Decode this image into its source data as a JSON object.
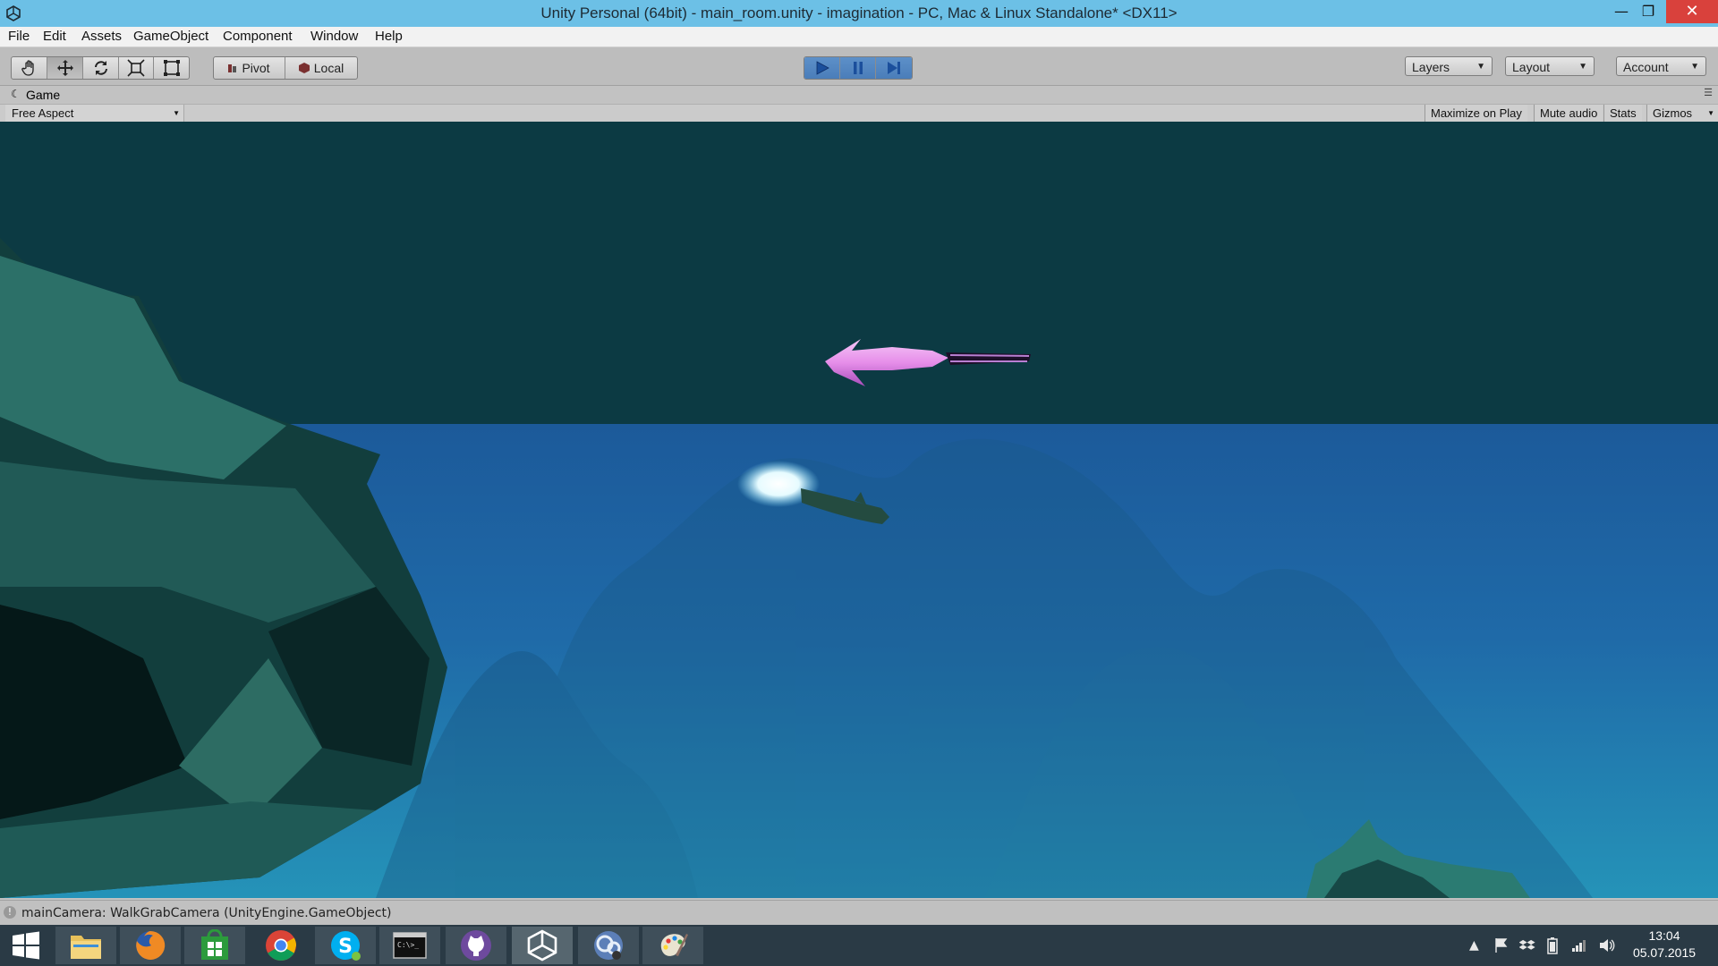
{
  "window": {
    "title": "Unity Personal (64bit) - main_room.unity - imagination - PC, Mac & Linux Standalone* <DX11>",
    "minimize_glyph": "—",
    "maximize_glyph": "❐",
    "close_glyph": "✕"
  },
  "menu": [
    "File",
    "Edit",
    "Assets",
    "GameObject",
    "Component",
    "Window",
    "Help"
  ],
  "toolbar": {
    "pivot_label": "Pivot",
    "local_label": "Local",
    "layers_label": "Layers",
    "layout_label": "Layout",
    "account_label": "Account"
  },
  "game_view": {
    "tab_label": "Game",
    "aspect_label": "Free Aspect",
    "maximize_label": "Maximize on Play",
    "mute_label": "Mute audio",
    "stats_label": "Stats",
    "gizmos_label": "Gizmos"
  },
  "status": {
    "message": "mainCamera: WalkGrabCamera (UnityEngine.GameObject)"
  },
  "taskbar": {
    "apps": [
      "windows-start",
      "file-explorer",
      "firefox",
      "store",
      "chrome",
      "skype",
      "command-prompt",
      "github",
      "unity",
      "monodevelop",
      "paint"
    ],
    "clock_time": "13:04",
    "clock_date": "05.07.2015"
  },
  "colors": {
    "title_bar": "#6cc0e6",
    "close_button": "#d9413c",
    "play_active": "#4a7db9",
    "taskbar": "#2a3a45",
    "sky": "#0c3a43",
    "water": "#1e64a6"
  }
}
